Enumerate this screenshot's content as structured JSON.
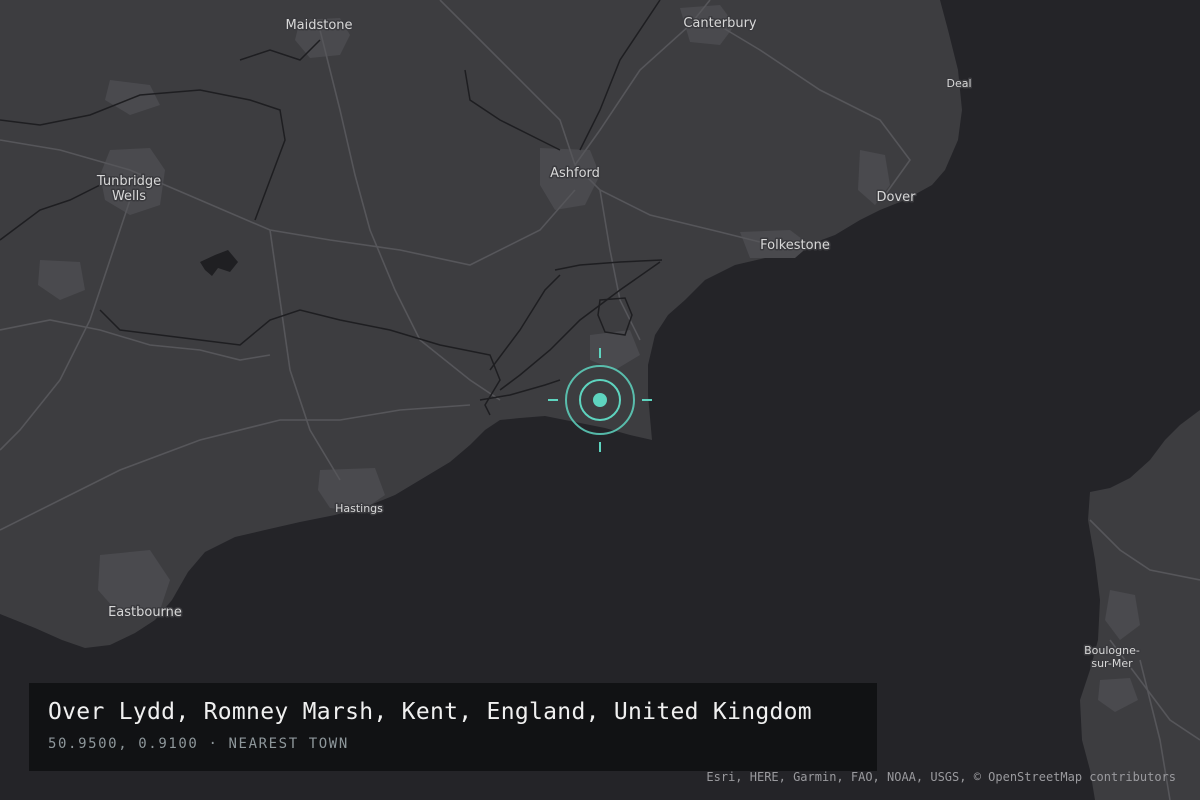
{
  "map": {
    "places": {
      "maidstone": "Maidstone",
      "canterbury": "Canterbury",
      "deal": "Deal",
      "tunbridge_wells_1": "Tunbridge",
      "tunbridge_wells_2": "Wells",
      "ashford": "Ashford",
      "dover": "Dover",
      "folkestone": "Folkestone",
      "hastings": "Hastings",
      "eastbourne": "Eastbourne",
      "boulogne_1": "Boulogne-",
      "boulogne_2": "sur-Mer"
    },
    "marker_icon": "crosshair-location-icon",
    "colors": {
      "land": "#3d3d40",
      "sea": "#242428",
      "roads": "#555559",
      "boundaries": "#1c1c1f",
      "urban": "#4a4a4e",
      "marker": "#5ed4bf"
    }
  },
  "info_panel": {
    "title": "Over Lydd, Romney Marsh, Kent, England, United Kingdom",
    "subtitle": "50.9500, 0.9100 · NEAREST TOWN"
  },
  "attribution": "Esri, HERE, Garmin, FAO, NOAA, USGS, © OpenStreetMap contributors"
}
